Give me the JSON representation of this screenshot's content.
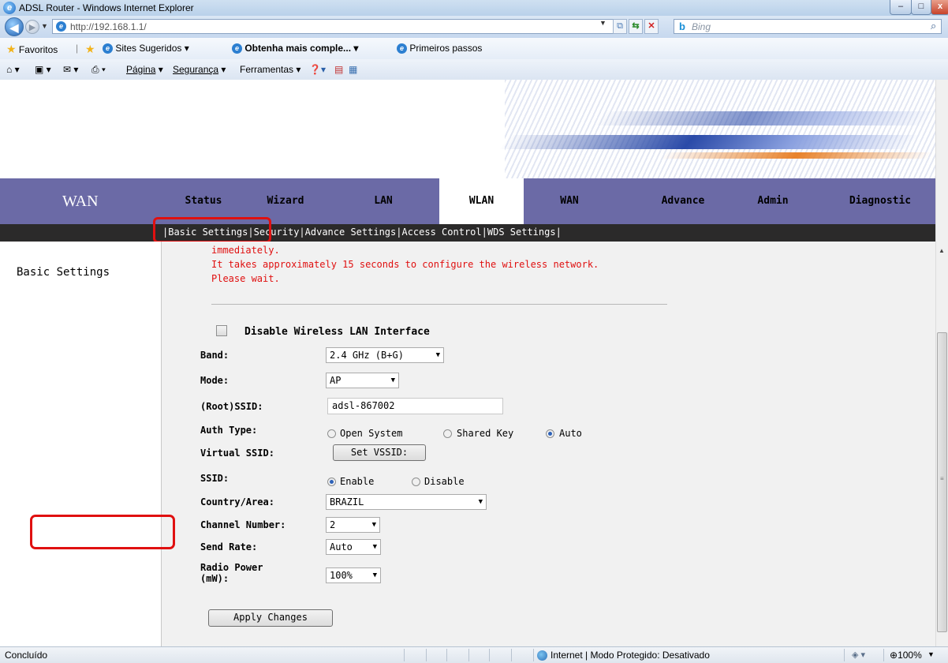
{
  "window": {
    "title": "ADSL Router - Windows Internet Explorer",
    "buttons": {
      "minimize": "–",
      "maximize": "□",
      "close": "x"
    }
  },
  "address_bar": {
    "url": "http://192.168.1.1/",
    "search_placeholder": "Bing"
  },
  "favorites_bar": {
    "favorites_label": "Favoritos",
    "items": [
      "Sites Sugeridos ▾",
      "Obtenha mais comple... ▾",
      "Primeiros passos"
    ]
  },
  "command_bar": {
    "page": "Página",
    "security": "Segurança",
    "tools": "Ferramentas"
  },
  "router_nav": {
    "logo": "WAN",
    "tabs": [
      "Status",
      "Wizard",
      "LAN",
      "WLAN",
      "WAN",
      "Advance",
      "Admin",
      "Diagnostic"
    ],
    "active_tab": "WLAN",
    "subnav": [
      "Basic Settings",
      "Security",
      "Advance Settings",
      "Access Control",
      "WDS Settings"
    ]
  },
  "sidebar": {
    "label": "Basic Settings"
  },
  "messages": {
    "line1": "immediately.",
    "line2": "It takes approximately 15 seconds to configure the wireless network.",
    "line3": "Please wait."
  },
  "form": {
    "disable_wlan_label": "Disable Wireless LAN Interface",
    "disable_wlan_checked": false,
    "band_label": "Band:",
    "band_value": "2.4 GHz (B+G)",
    "mode_label": "Mode:",
    "mode_value": "AP",
    "ssid_label": "(Root)SSID:",
    "ssid_value": "adsl-867002",
    "auth_label": "Auth Type:",
    "auth_options": [
      "Open System",
      "Shared Key",
      "Auto"
    ],
    "auth_selected": "Auto",
    "vssid_label": "Virtual SSID:",
    "vssid_button": "Set VSSID:",
    "ssid_bcast_label": "SSID:",
    "ssid_bcast_options": [
      "Enable",
      "Disable"
    ],
    "ssid_bcast_selected": "Enable",
    "country_label": "Country/Area:",
    "country_value": "BRAZIL",
    "channel_label": "Channel Number:",
    "channel_value": "2",
    "rate_label": "Send Rate:",
    "rate_value": "Auto",
    "power_label_1": "Radio Power",
    "power_label_2": "(mW):",
    "power_value": "100%",
    "apply_button": "Apply Changes"
  },
  "status_bar": {
    "text": "Concluído",
    "zone": "Internet | Modo Protegido: Desativado",
    "zoom": "100%"
  },
  "colors": {
    "nav_bg": "#6b6aa6",
    "subnav_bg": "#2b2a2a",
    "message_red": "#e01010",
    "highlight_red": "#e01010"
  }
}
